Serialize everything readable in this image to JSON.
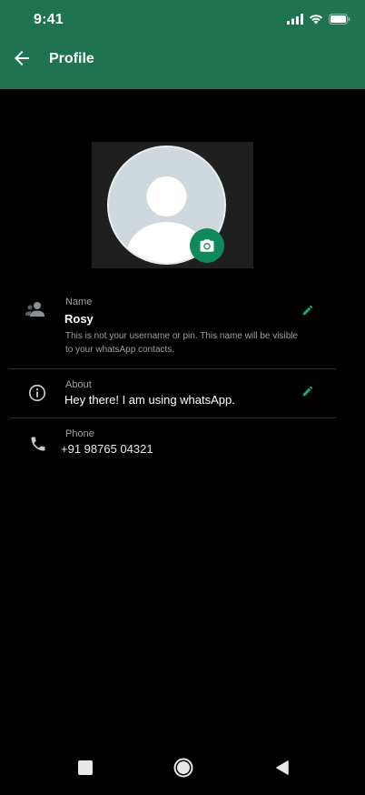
{
  "status_bar": {
    "time": "9:41",
    "icons": [
      "signal-icon",
      "wifi-icon",
      "battery-icon"
    ]
  },
  "header": {
    "title": "Profile",
    "back_icon": "arrow-left-icon"
  },
  "colors": {
    "header_bg": "#1e7350",
    "accent": "#0e8a5c",
    "background": "#000000"
  },
  "profile": {
    "avatar_icon": "default-avatar",
    "camera_icon": "camera-icon"
  },
  "fields": {
    "name": {
      "label": "Name",
      "value": "Rosy",
      "hint": "This is not your username or pin. This name will be visible to your whatsApp contacts.",
      "icon": "person-icon",
      "edit_icon": "pencil-icon"
    },
    "about": {
      "label": "About",
      "value": "Hey there! I am using whatsApp.",
      "icon": "info-icon",
      "edit_icon": "pencil-icon"
    },
    "phone": {
      "label": "Phone",
      "value": "+91 98765 04321",
      "icon": "phone-icon"
    }
  },
  "nav": {
    "icons": [
      "square-icon",
      "home-circle-icon",
      "back-triangle-icon"
    ]
  }
}
